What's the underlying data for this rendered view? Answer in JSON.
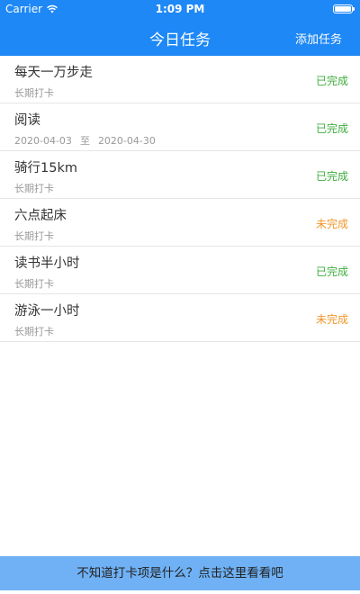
{
  "status_bar": {
    "carrier": "Carrier",
    "time": "1:09 PM",
    "wifi_icon": "wifi-icon",
    "battery_icon": "battery-icon"
  },
  "nav": {
    "title": "今日任务",
    "add_task": "添加任务"
  },
  "tasks": [
    {
      "title": "每天一万步走",
      "subtitle_type": "text",
      "subtitle": "长期打卡",
      "status": "已完成",
      "done": true
    },
    {
      "title": "阅读",
      "subtitle_type": "range",
      "start": "2020-04-03",
      "sep": "至",
      "end": "2020-04-30",
      "status": "已完成",
      "done": true
    },
    {
      "title": "骑行15km",
      "subtitle_type": "text",
      "subtitle": "长期打卡",
      "status": "已完成",
      "done": true
    },
    {
      "title": "六点起床",
      "subtitle_type": "text",
      "subtitle": "长期打卡",
      "status": "未完成",
      "done": false
    },
    {
      "title": "读书半小时",
      "subtitle_type": "text",
      "subtitle": "长期打卡",
      "status": "已完成",
      "done": true
    },
    {
      "title": "游泳一小时",
      "subtitle_type": "text",
      "subtitle": "长期打卡",
      "status": "未完成",
      "done": false
    }
  ],
  "footer": {
    "hint": "不知道打卡项是什么？点击这里看看吧"
  },
  "colors": {
    "nav_bg": "#1e88f6",
    "done": "#3dae3d",
    "todo": "#f0962a",
    "footer_bg": "#6fb1f4"
  }
}
